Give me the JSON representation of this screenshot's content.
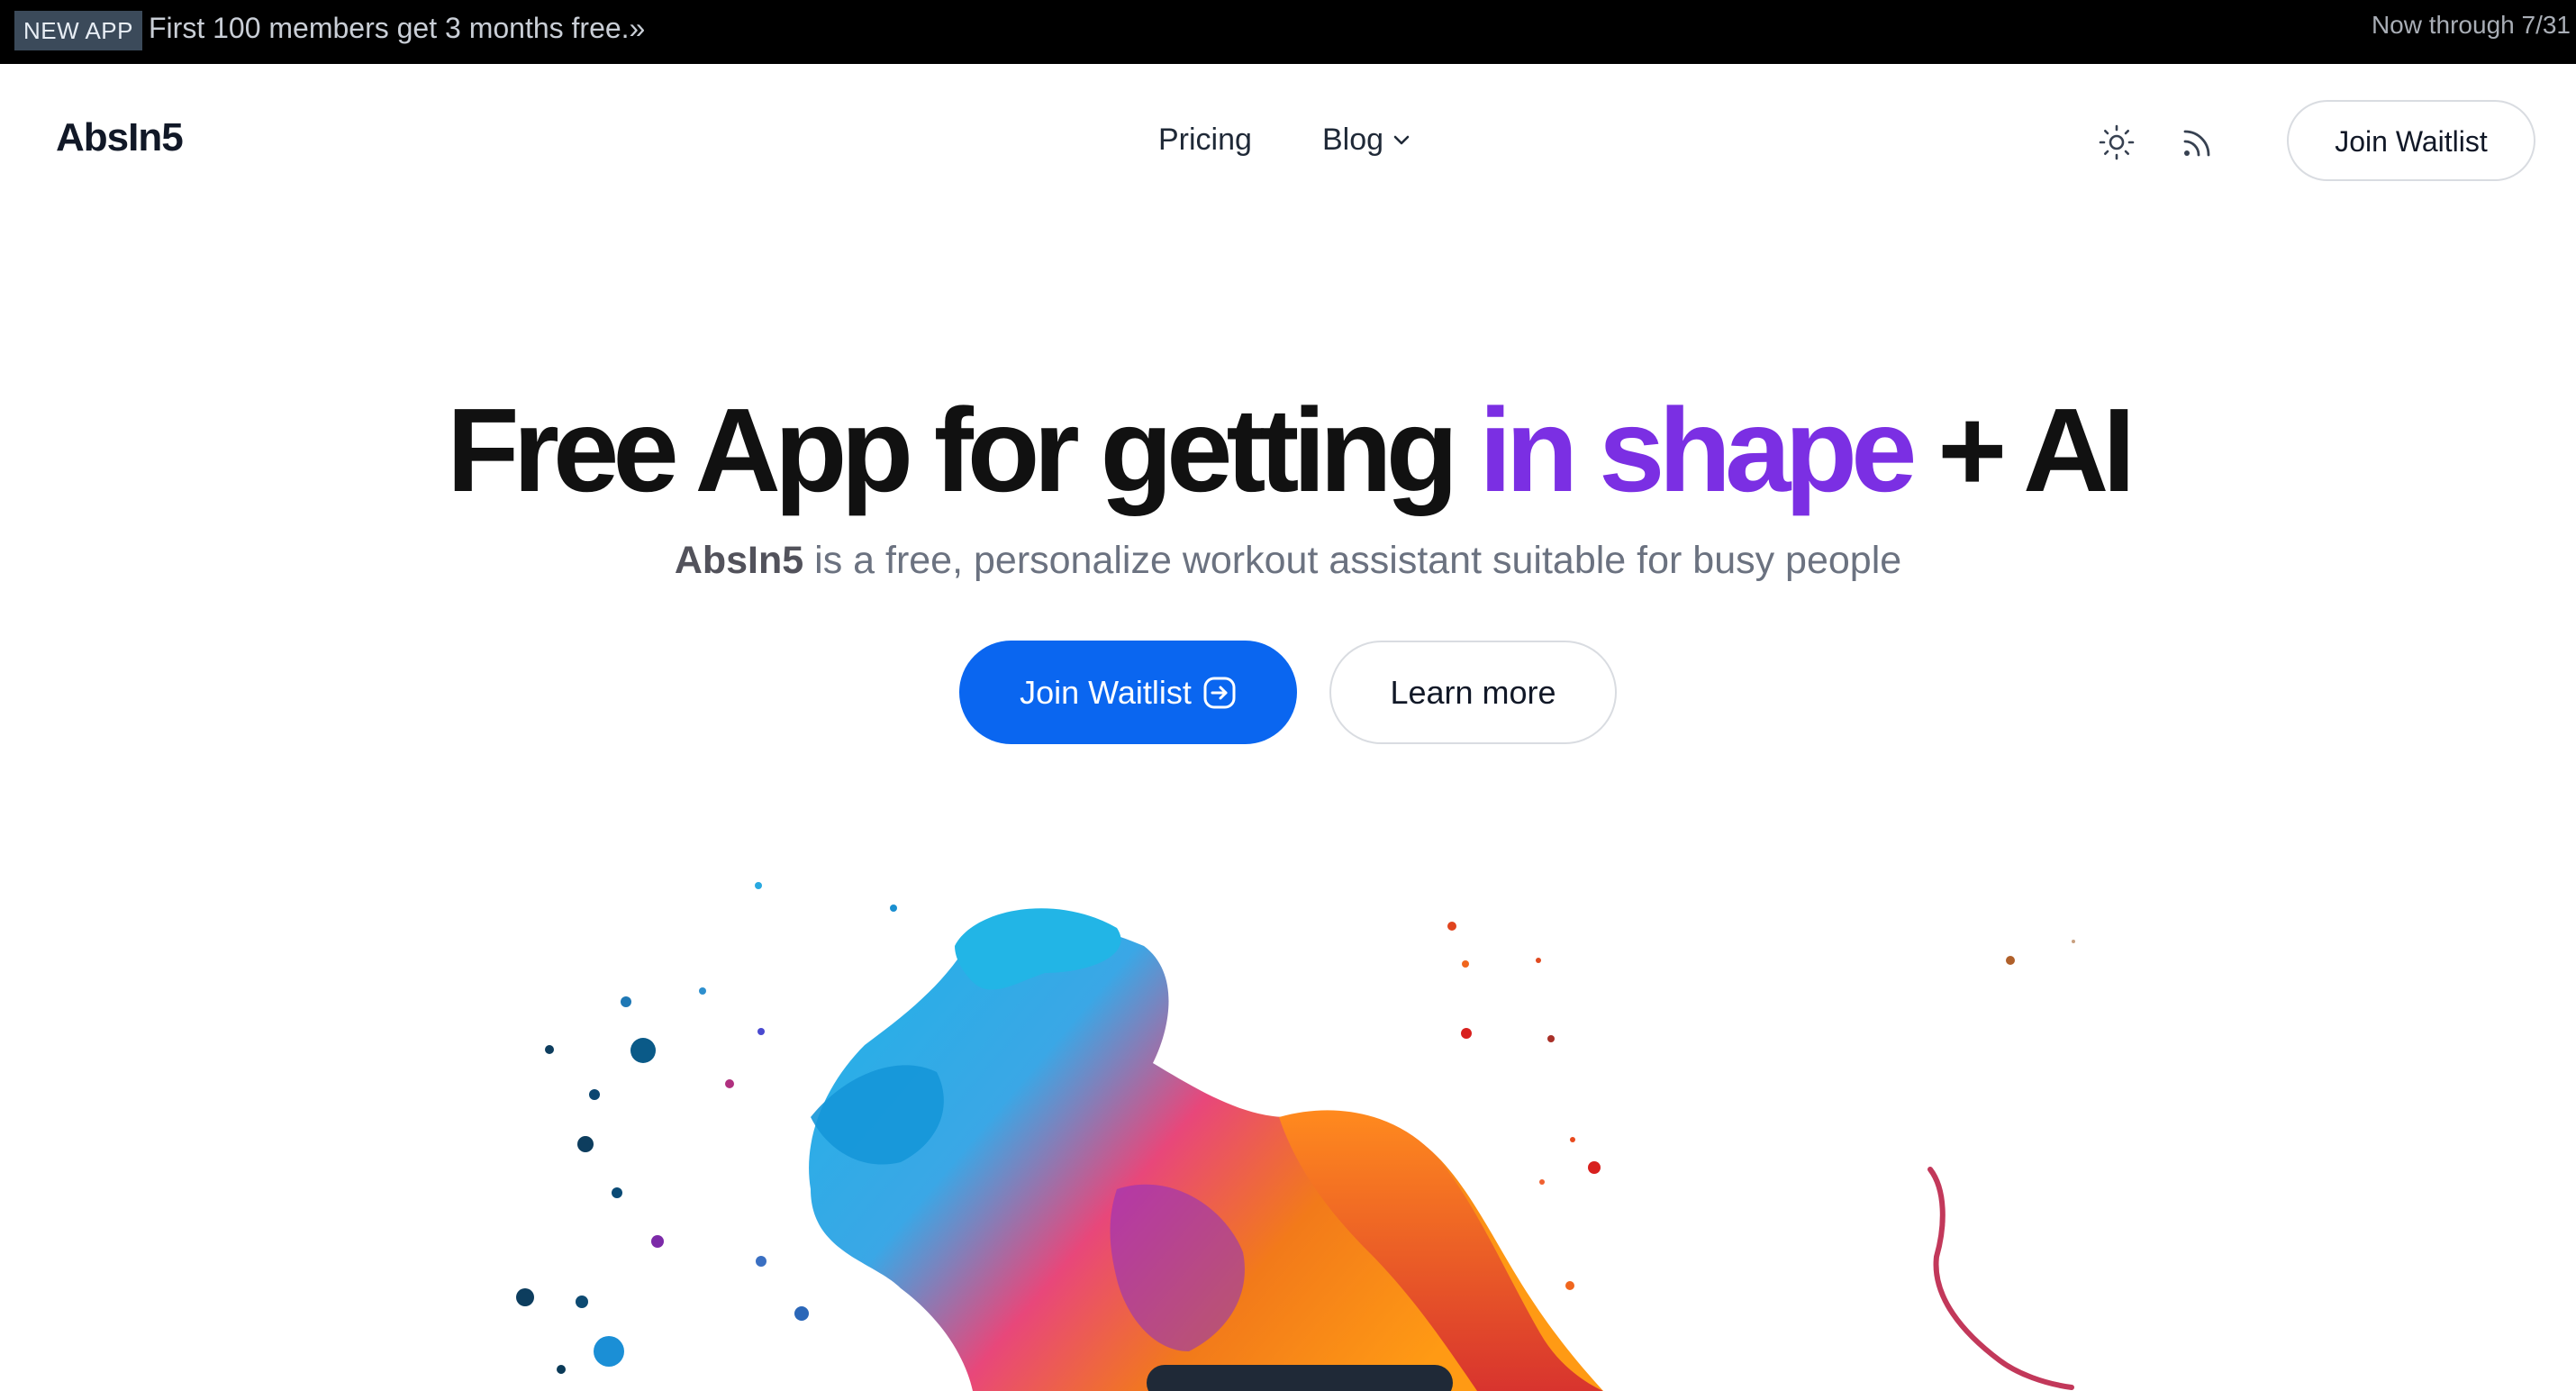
{
  "banner": {
    "badge": "NEW APP",
    "promo_text": "First 100 members get 3 months free.»",
    "through_text": "Now through 7/31"
  },
  "header": {
    "logo": "AbsIn5",
    "nav": {
      "pricing": "Pricing",
      "blog": "Blog"
    },
    "icons": {
      "theme": "sun-icon",
      "feed": "rss-icon",
      "chevron": "chevron-down-icon"
    },
    "join_label": "Join Waitlist"
  },
  "hero": {
    "title_start": "Free App for getting ",
    "title_accent": "in shape",
    "title_end": " + AI",
    "subtitle_brand": "AbsIn5",
    "subtitle_rest": " is a free, personalize workout assistant suitable for busy people",
    "primary_label": "Join Waitlist",
    "secondary_label": "Learn more",
    "primary_icon": "arrow-right-circle-icon"
  },
  "colors": {
    "accent": "#7b2fe3",
    "primary": "#0a66f0",
    "banner_bg": "#000000"
  }
}
